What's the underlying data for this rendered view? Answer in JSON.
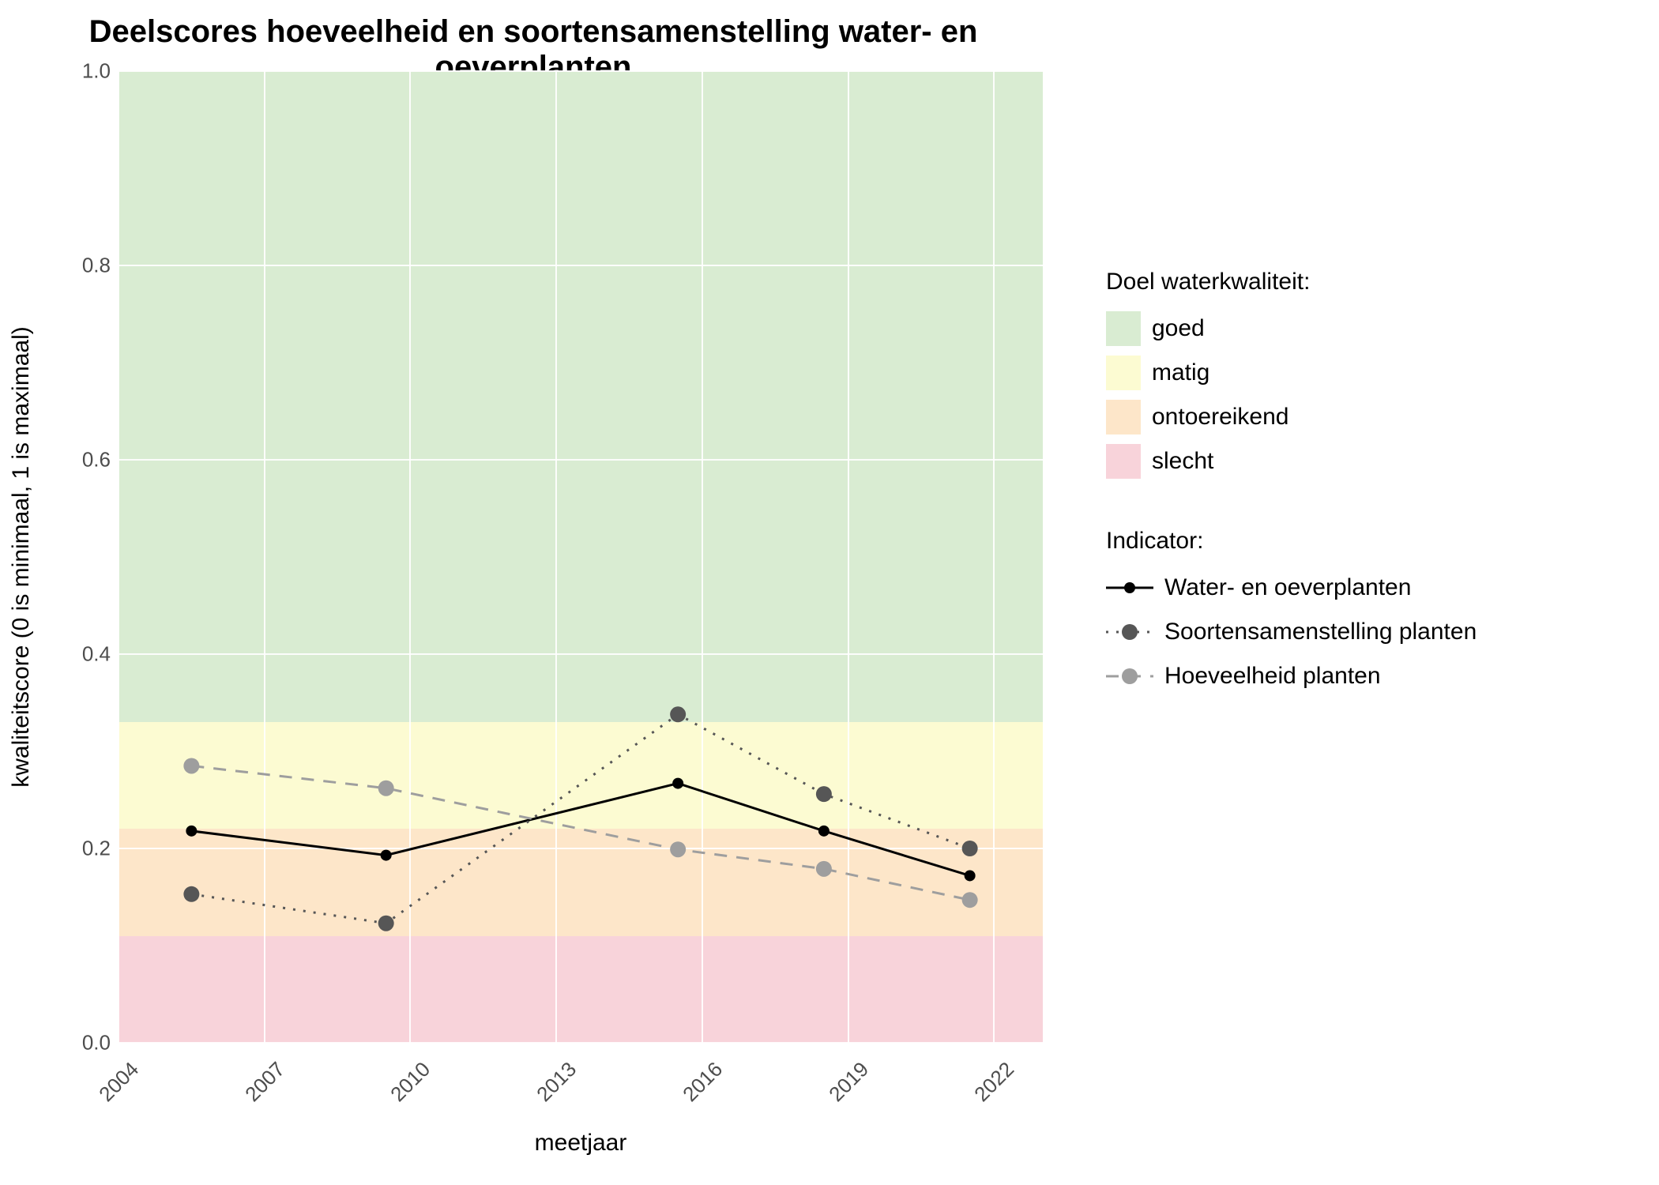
{
  "chart_data": {
    "type": "line",
    "title": "Deelscores hoeveelheid en soortensamenstelling water- en oeverplanten",
    "xlabel": "meetjaar",
    "ylabel": "kwaliteitscore (0 is minimaal, 1 is maximaal)",
    "x_ticks": [
      2004,
      2007,
      2010,
      2013,
      2016,
      2019,
      2022
    ],
    "y_ticks": [
      0.0,
      0.2,
      0.4,
      0.6,
      0.8,
      1.0
    ],
    "xlim": [
      2004,
      2023
    ],
    "ylim": [
      0.0,
      1.0
    ],
    "series": [
      {
        "name": "Water- en oeverplanten",
        "color": "#000000",
        "line": "solid",
        "x": [
          2005.5,
          2009.5,
          2015.5,
          2018.5,
          2021.5
        ],
        "values": [
          0.218,
          0.193,
          0.267,
          0.218,
          0.172
        ]
      },
      {
        "name": "Soortensamenstelling planten",
        "color": "#565656",
        "line": "dotted",
        "x": [
          2005.5,
          2009.5,
          2015.5,
          2018.5,
          2021.5
        ],
        "values": [
          0.153,
          0.123,
          0.338,
          0.256,
          0.2
        ]
      },
      {
        "name": "Hoeveelheid planten",
        "color": "#9e9e9e",
        "line": "dashed",
        "x": [
          2005.5,
          2009.5,
          2015.5,
          2018.5,
          2021.5
        ],
        "values": [
          0.285,
          0.262,
          0.199,
          0.179,
          0.147
        ]
      }
    ],
    "bands_legend_title": "Doel waterkwaliteit:",
    "bands": [
      {
        "name": "goed",
        "color": "#d9ecd2",
        "from": 0.33,
        "to": 1.0
      },
      {
        "name": "matig",
        "color": "#fcfbd2",
        "from": 0.22,
        "to": 0.33
      },
      {
        "name": "ontoereikend",
        "color": "#fde6c9",
        "from": 0.11,
        "to": 0.22
      },
      {
        "name": "slecht",
        "color": "#f8d3da",
        "from": 0.0,
        "to": 0.11
      }
    ],
    "indicator_legend_title": "Indicator:"
  }
}
